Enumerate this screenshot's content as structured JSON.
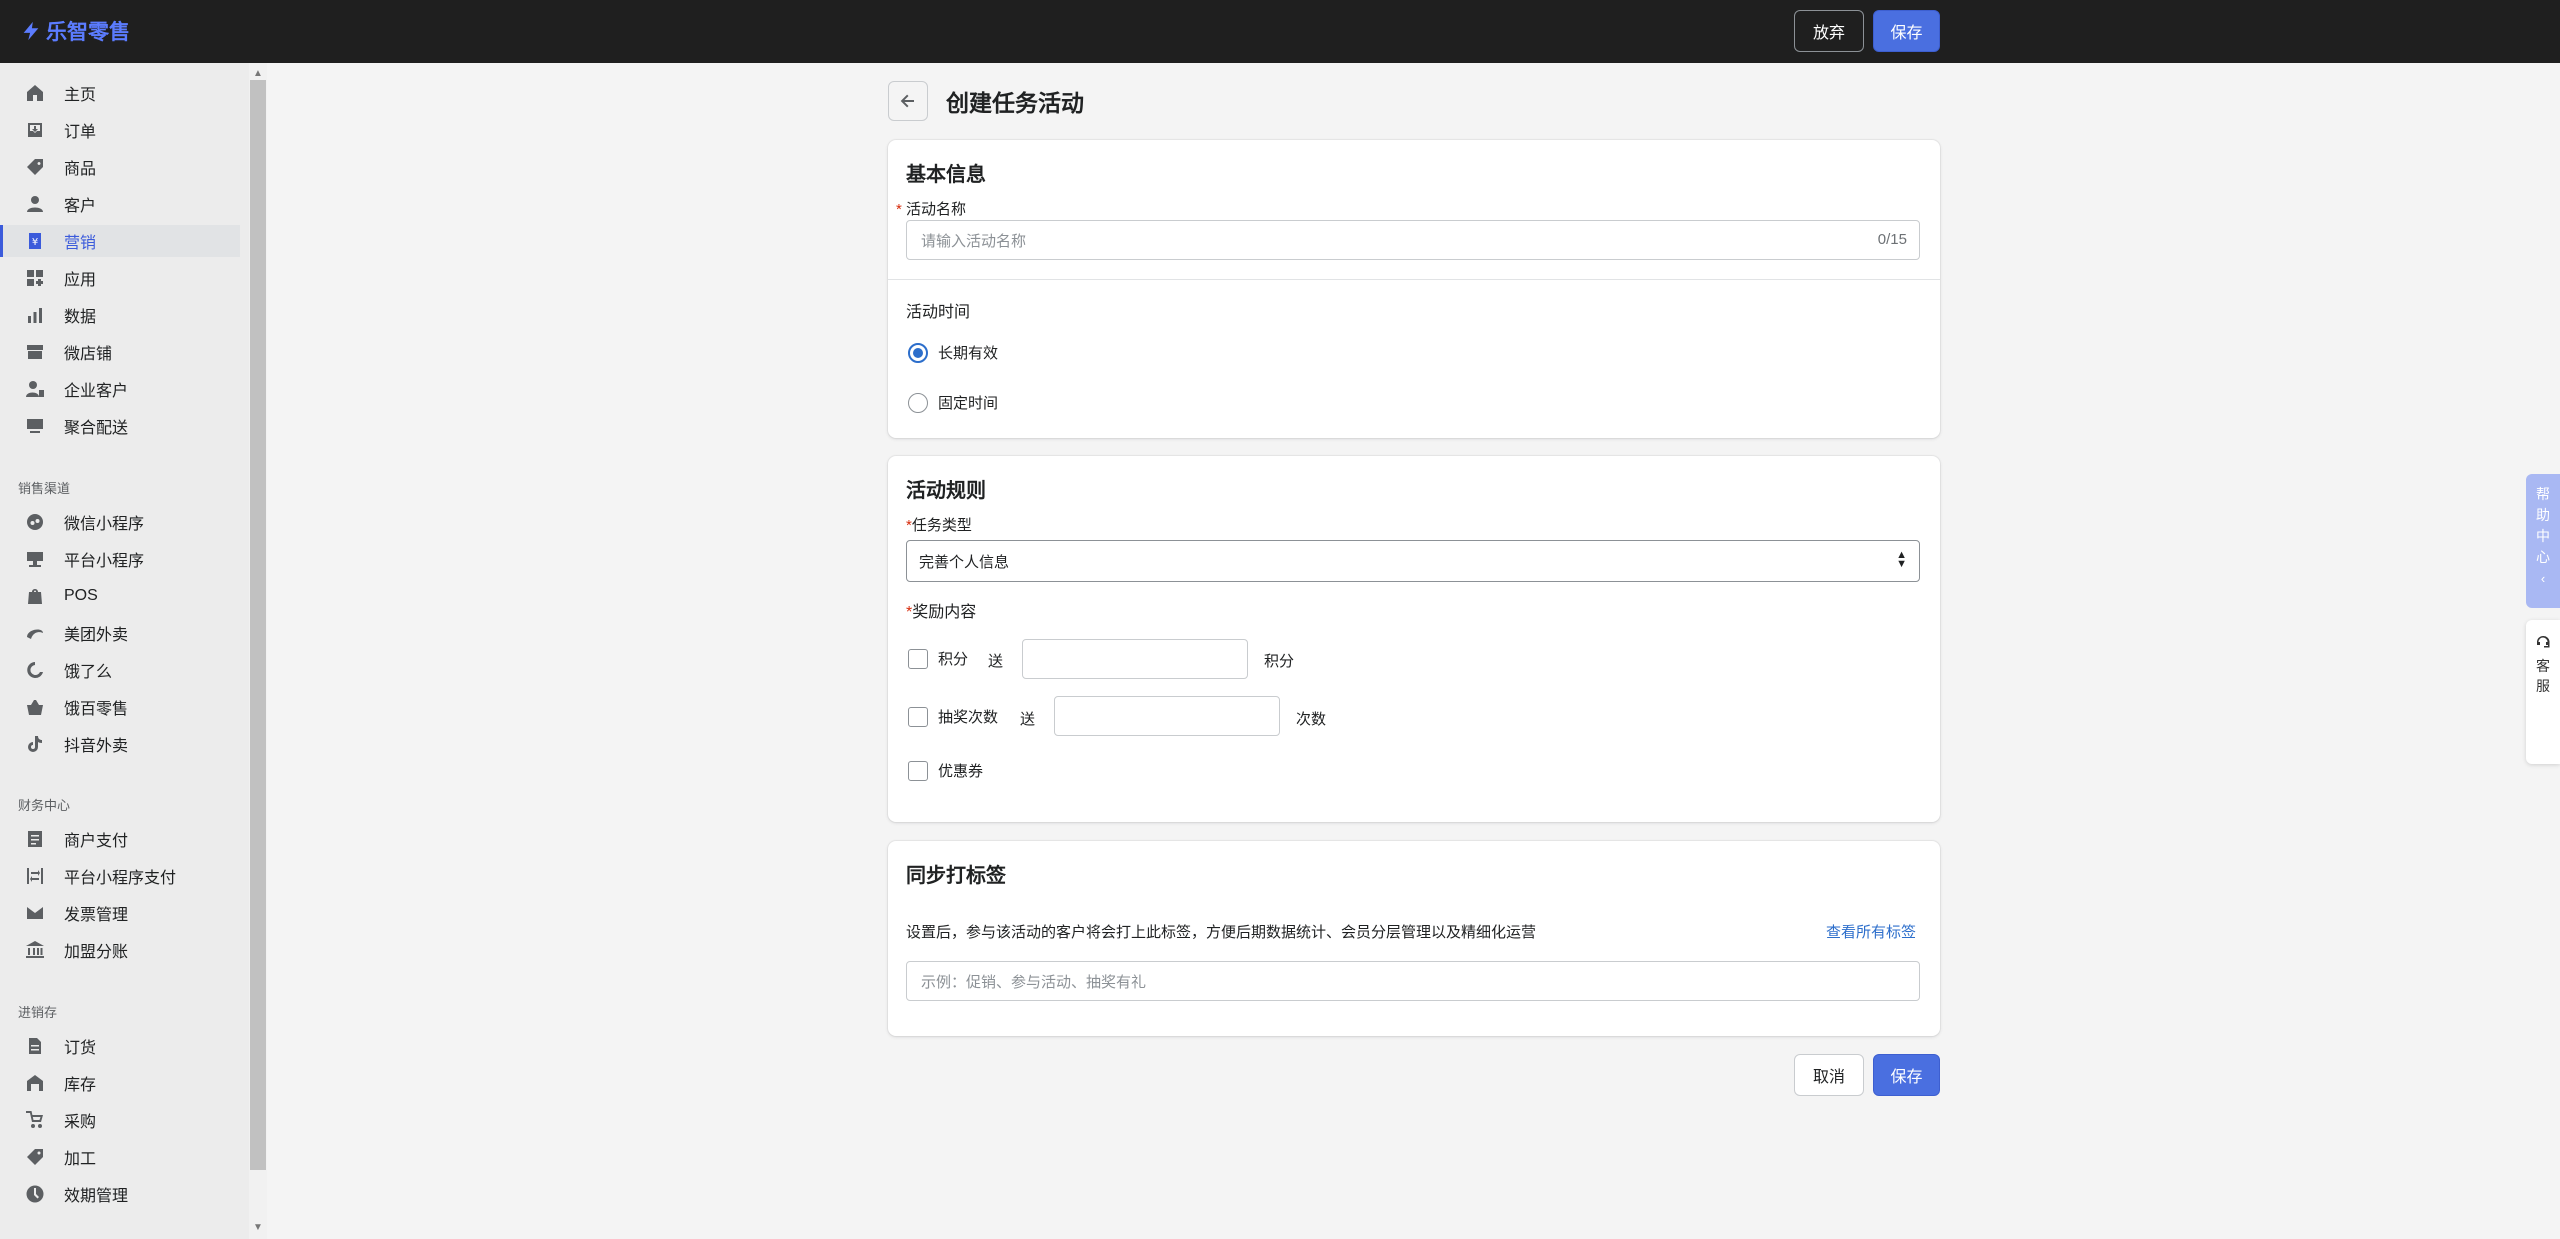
{
  "app": {
    "logo_text": "乐智零售",
    "brand_color": "#4a6fe0",
    "topbar_discard": "放弃",
    "topbar_save": "保存"
  },
  "sidebar": {
    "main_items": [
      {
        "label": "主页",
        "icon": "home-icon"
      },
      {
        "label": "订单",
        "icon": "orders-icon"
      },
      {
        "label": "商品",
        "icon": "tag-icon"
      },
      {
        "label": "客户",
        "icon": "person-icon"
      },
      {
        "label": "营销",
        "icon": "marketing-icon",
        "active": true
      },
      {
        "label": "应用",
        "icon": "apps-icon"
      },
      {
        "label": "数据",
        "icon": "bar-chart-icon"
      },
      {
        "label": "微店铺",
        "icon": "store-icon"
      },
      {
        "label": "企业客户",
        "icon": "enterprise-person-icon"
      },
      {
        "label": "聚合配送",
        "icon": "delivery-icon"
      }
    ],
    "sales_section": "销售渠道",
    "sales_items": [
      {
        "label": "微信小程序",
        "icon": "wechat-miniprogram-icon"
      },
      {
        "label": "平台小程序",
        "icon": "platform-miniprogram-icon"
      },
      {
        "label": "POS",
        "icon": "pos-icon"
      },
      {
        "label": "美团外卖",
        "icon": "meituan-icon"
      },
      {
        "label": "饿了么",
        "icon": "eleme-icon"
      },
      {
        "label": "饿百零售",
        "icon": "basket-icon"
      },
      {
        "label": "抖音外卖",
        "icon": "tiktok-icon"
      }
    ],
    "finance_section": "财务中心",
    "finance_items": [
      {
        "label": "商户支付",
        "icon": "payment-icon"
      },
      {
        "label": "平台小程序支付",
        "icon": "transfer-icon"
      },
      {
        "label": "发票管理",
        "icon": "invoice-icon"
      },
      {
        "label": "加盟分账",
        "icon": "bank-icon"
      }
    ],
    "inventory_section": "进销存",
    "inventory_items": [
      {
        "label": "订货",
        "icon": "document-icon"
      },
      {
        "label": "库存",
        "icon": "warehouse-icon"
      },
      {
        "label": "采购",
        "icon": "purchase-icon"
      },
      {
        "label": "加工",
        "icon": "process-icon"
      },
      {
        "label": "效期管理",
        "icon": "clock-icon"
      }
    ]
  },
  "page": {
    "title": "创建任务活动"
  },
  "basic_info": {
    "title": "基本信息",
    "name_label": "活动名称",
    "name_placeholder": "请输入活动名称",
    "name_counter": "0/15",
    "time_label": "活动时间",
    "time_options": [
      "长期有效",
      "固定时间"
    ],
    "time_selected": "长期有效"
  },
  "rules": {
    "title": "活动规则",
    "task_type_label": "任务类型",
    "task_type_value": "完善个人信息",
    "reward_label": "奖励内容",
    "points_label": "积分",
    "points_give": "送",
    "points_unit": "积分",
    "lottery_label": "抽奖次数",
    "lottery_give": "送",
    "lottery_unit": "次数",
    "coupon_label": "优惠券"
  },
  "tags": {
    "title": "同步打标签",
    "description": "设置后，参与该活动的客户将会打上此标签，方便后期数据统计、会员分层管理以及精细化运营",
    "view_all_link": "查看所有标签",
    "placeholder": "示例：促销、参与活动、抽奖有礼"
  },
  "footer": {
    "cancel": "取消",
    "save": "保存"
  },
  "floating": {
    "help_center": "帮助中心",
    "customer_service": "客服"
  }
}
